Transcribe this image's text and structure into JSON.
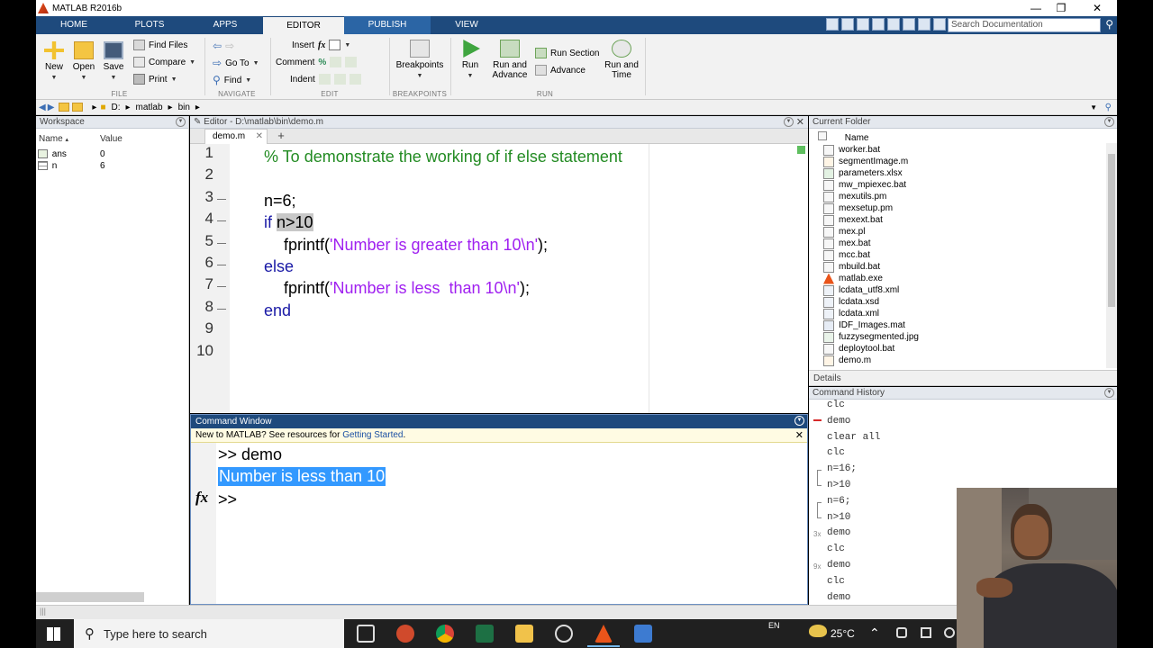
{
  "window": {
    "title": "MATLAB R2016b",
    "minimize_icon": "minimize-icon",
    "maximize_icon": "maximize-icon",
    "close_icon": "close-icon"
  },
  "ribbon_tabs": [
    "HOME",
    "PLOTS",
    "APPS",
    "EDITOR",
    "PUBLISH",
    "VIEW"
  ],
  "active_tab": "EDITOR",
  "search": {
    "placeholder": "Search Documentation"
  },
  "ribbon": {
    "file": {
      "new": "New",
      "open": "Open",
      "save": "Save",
      "find_files": "Find Files",
      "compare": "Compare",
      "print": "Print",
      "group": "FILE"
    },
    "navigate": {
      "go_to": "Go To",
      "find": "Find",
      "group": "NAVIGATE"
    },
    "edit": {
      "insert": "Insert",
      "comment": "Comment",
      "indent": "Indent",
      "fx": "fx",
      "group": "EDIT"
    },
    "breakpoints": {
      "label": "Breakpoints",
      "group": "BREAKPOINTS"
    },
    "run": {
      "run": "Run",
      "run_and_advance_1": "Run and",
      "run_and_advance_2": "Advance",
      "run_section": "Run Section",
      "advance": "Advance",
      "run_and_time_1": "Run and",
      "run_and_time_2": "Time",
      "group": "RUN"
    }
  },
  "address": {
    "parts": [
      "D:",
      "matlab",
      "bin"
    ]
  },
  "workspace": {
    "title": "Workspace",
    "columns": [
      "Name",
      "Value"
    ],
    "rows": [
      {
        "name": "ans",
        "value": "0"
      },
      {
        "name": "n",
        "value": "6"
      }
    ]
  },
  "editor": {
    "title": "Editor - D:\\matlab\\bin\\demo.m",
    "tab": "demo.m",
    "add_tab": "+",
    "line_numbers": [
      "1",
      "2",
      "3",
      "4",
      "5",
      "6",
      "7",
      "8",
      "9",
      "10"
    ],
    "lines": {
      "l1": "% To demonstrate the working of if else statement",
      "l3": "n=6;",
      "l4_kw": "if",
      "l4_rest": "n>10",
      "l5_fn": "fprintf(",
      "l5_str": "'Number is greater than 10\\n'",
      "l5_end": ");",
      "l6_kw": "else",
      "l7_fn": "fprintf(",
      "l7_str": "'Number is less  than 10\\n'",
      "l7_end": ");",
      "l8_kw": "end"
    }
  },
  "command_window": {
    "title": "Command Window",
    "info_prefix": "New to MATLAB? See resources for ",
    "info_link": "Getting Started",
    "info_suffix": ".",
    "line1": ">> demo",
    "line2": "Number is less  than 10",
    "prompt": ">>",
    "fx": "fx"
  },
  "current_folder": {
    "title": "Current Folder",
    "column": "Name",
    "files": [
      "worker.bat",
      "segmentImage.m",
      "parameters.xlsx",
      "mw_mpiexec.bat",
      "mexutils.pm",
      "mexsetup.pm",
      "mexext.bat",
      "mex.pl",
      "mex.bat",
      "mcc.bat",
      "mbuild.bat",
      "matlab.exe",
      "lcdata_utf8.xml",
      "lcdata.xsd",
      "lcdata.xml",
      "IDF_Images.mat",
      "fuzzysegmented.jpg",
      "deploytool.bat",
      "demo.m"
    ]
  },
  "details": {
    "title": "Details"
  },
  "command_history": {
    "title": "Command History",
    "items": [
      {
        "cmd": "clc",
        "count": ""
      },
      {
        "cmd": "demo",
        "count": ""
      },
      {
        "cmd": "clear all",
        "count": ""
      },
      {
        "cmd": "clc",
        "count": ""
      },
      {
        "cmd": "n=16;",
        "count": ""
      },
      {
        "cmd": "n>10",
        "count": ""
      },
      {
        "cmd": "n=6;",
        "count": ""
      },
      {
        "cmd": "n>10",
        "count": ""
      },
      {
        "cmd": "demo",
        "count": "3x"
      },
      {
        "cmd": "clc",
        "count": ""
      },
      {
        "cmd": "demo",
        "count": "9x"
      },
      {
        "cmd": "clc",
        "count": ""
      },
      {
        "cmd": "demo",
        "count": ""
      }
    ]
  },
  "taskbar": {
    "search_placeholder": "Type here to search",
    "lang": "EN",
    "weather": "25°C"
  },
  "colors": {
    "ribbon_blue": "#1e4a7d",
    "comment_green": "#228b22",
    "string_purple": "#a020f0",
    "keyword_blue": "#1a1aa6",
    "selection_blue": "#3399ff"
  }
}
